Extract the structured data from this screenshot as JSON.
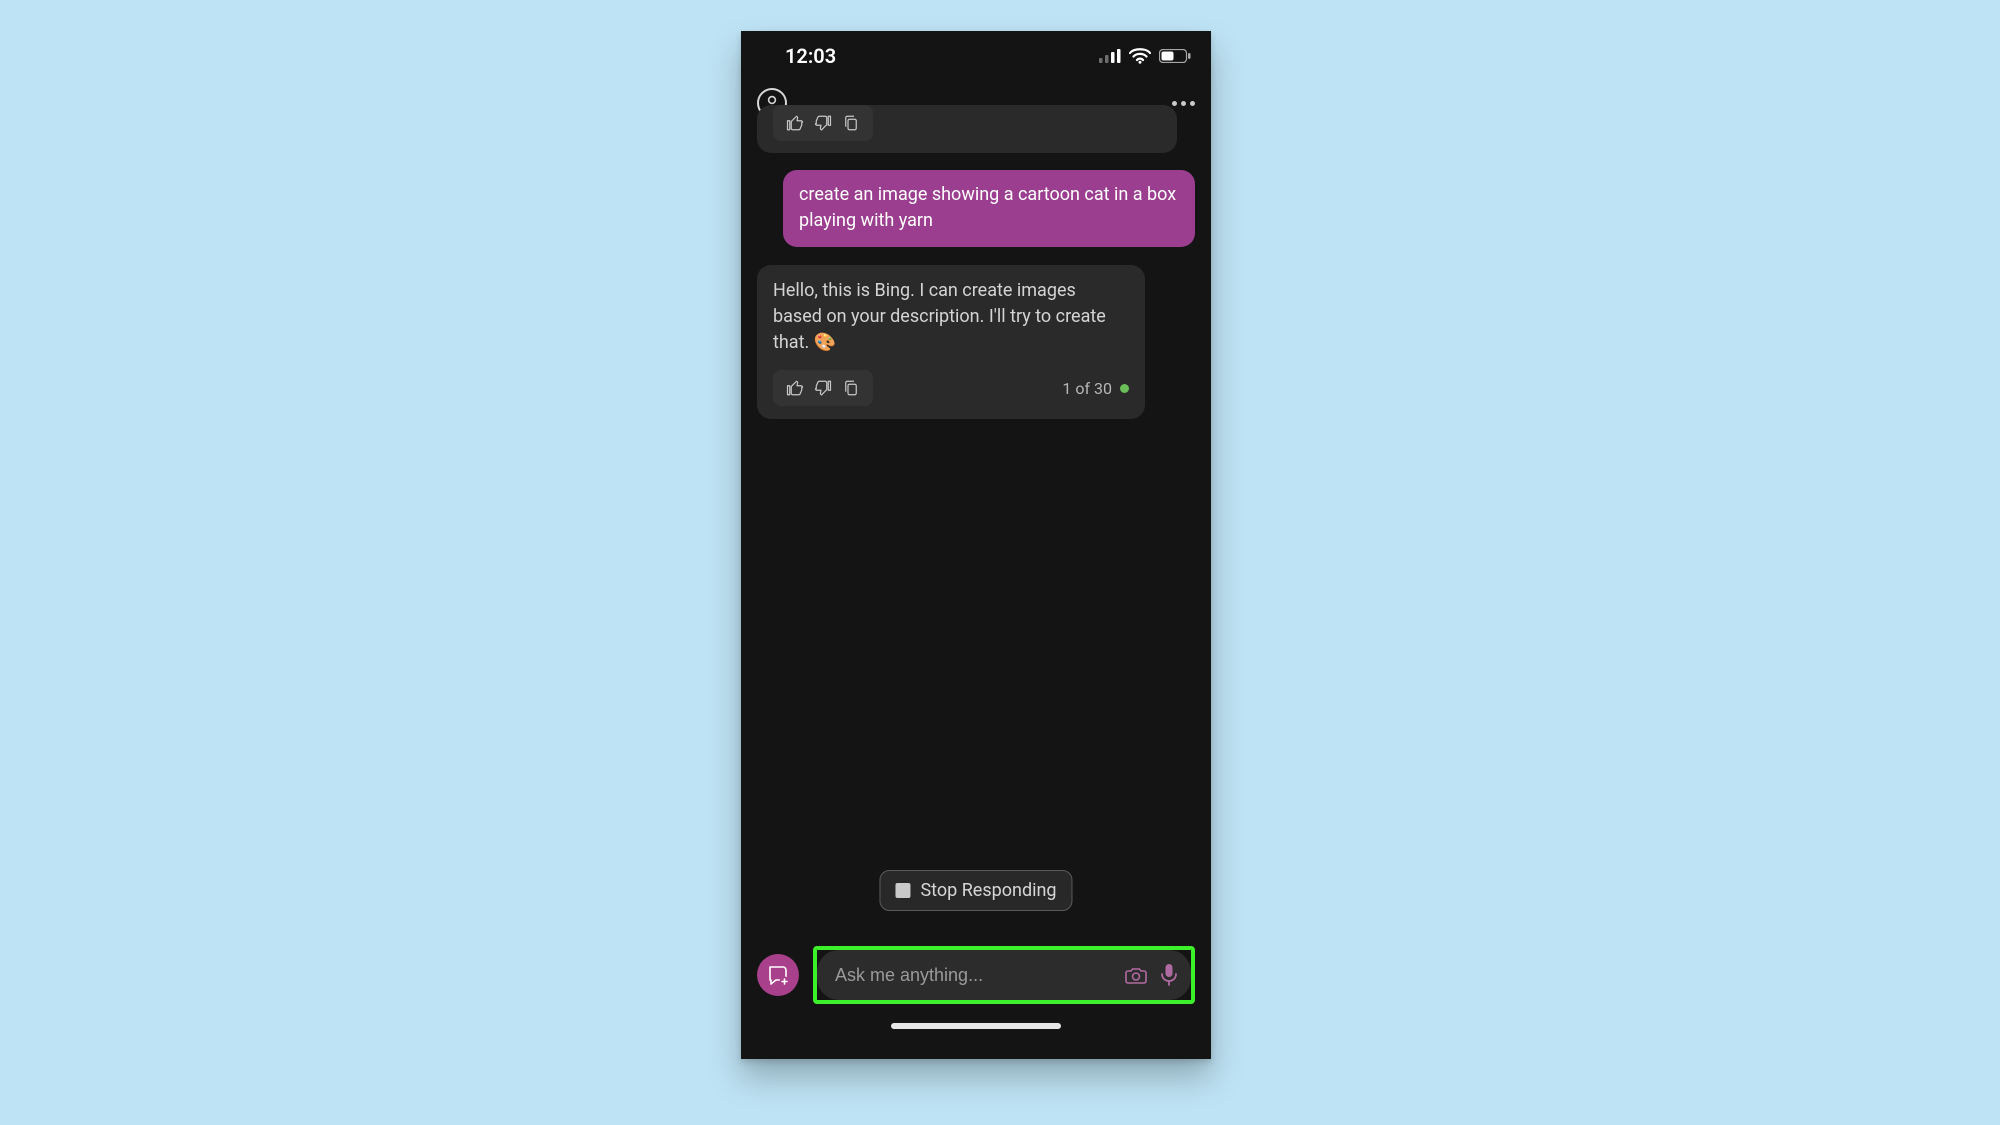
{
  "statusBar": {
    "time": "12:03"
  },
  "chat": {
    "userMessage": "create an image showing a cartoon cat in a box playing with yarn",
    "aiMessage": "Hello, this is Bing. I can create images based on your description. I'll try to create that. 🎨",
    "counter": "1 of 30"
  },
  "stopButton": {
    "label": "Stop Responding"
  },
  "input": {
    "placeholder": "Ask me anything..."
  },
  "colors": {
    "pageBg": "#bee3f4",
    "phoneBg": "#141414",
    "userBubble": "#9b3e90",
    "aiBubble": "#2a2a2a",
    "highlight": "#3df12a",
    "newTopic": "#a9408b"
  }
}
